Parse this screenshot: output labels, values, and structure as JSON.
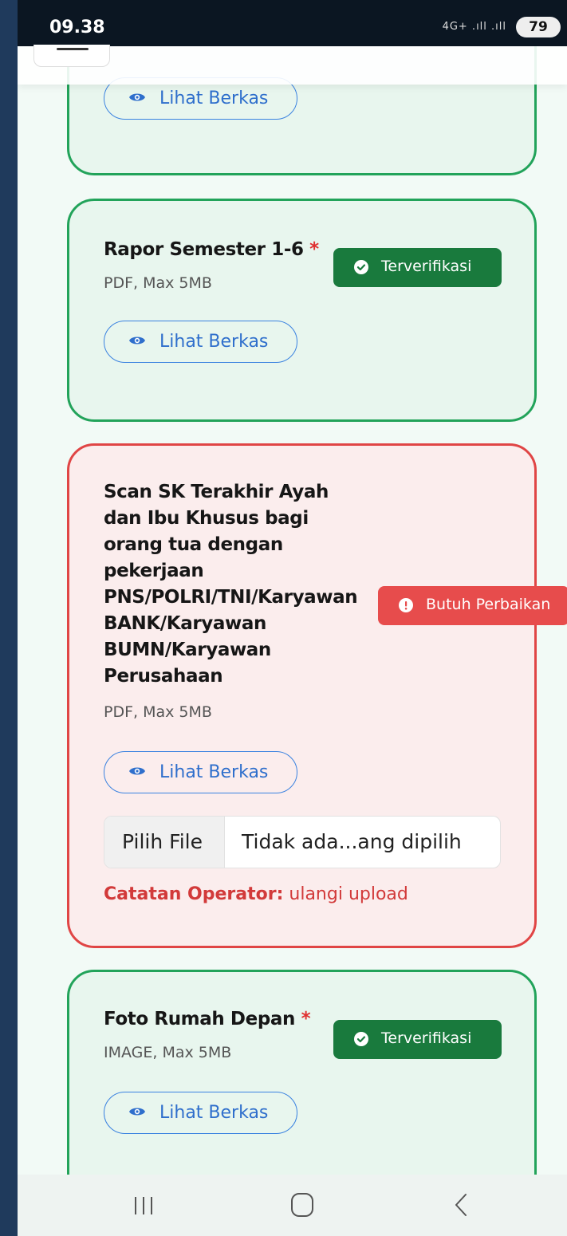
{
  "status_bar": {
    "time": "09.38",
    "signal": "4G+ .ıll .ıll",
    "battery": "79"
  },
  "cards": [
    {
      "state": "verified",
      "view_label": "Lihat Berkas"
    },
    {
      "state": "verified",
      "title": "Rapor Semester 1-6",
      "required_mark": "*",
      "meta": "PDF, Max 5MB",
      "badge": "Terverifikasi",
      "view_label": "Lihat Berkas"
    },
    {
      "state": "needs_fix",
      "title_lines": [
        "Scan SK Terakhir Ayah",
        "dan Ibu Khusus bagi",
        "orang tua dengan",
        "pekerjaan",
        "PNS/POLRI/TNI/Karyawan",
        "BANK/Karyawan",
        "BUMN/Karyawan",
        "Perusahaan"
      ],
      "meta": "PDF, Max 5MB",
      "badge": "Butuh Perbaikan",
      "view_label": "Lihat Berkas",
      "file_button": "Pilih File",
      "file_name": "Tidak ada...ang dipilih",
      "note_label": "Catatan Operator:",
      "note_text": "ulangi upload"
    },
    {
      "state": "verified",
      "title": "Foto Rumah Depan",
      "required_mark": "*",
      "meta": "IMAGE, Max 5MB",
      "badge": "Terverifikasi",
      "view_label": "Lihat Berkas"
    }
  ],
  "colors": {
    "verified_border": "#22a35a",
    "verified_badge": "#197a3d",
    "error_border": "#e04545",
    "error_badge": "#e74c4c",
    "link_blue": "#2f6fcc"
  },
  "icons": [
    "eye-icon",
    "check-circle-icon",
    "alert-circle-icon",
    "recents-icon",
    "home-icon",
    "back-icon",
    "menu-icon"
  ]
}
